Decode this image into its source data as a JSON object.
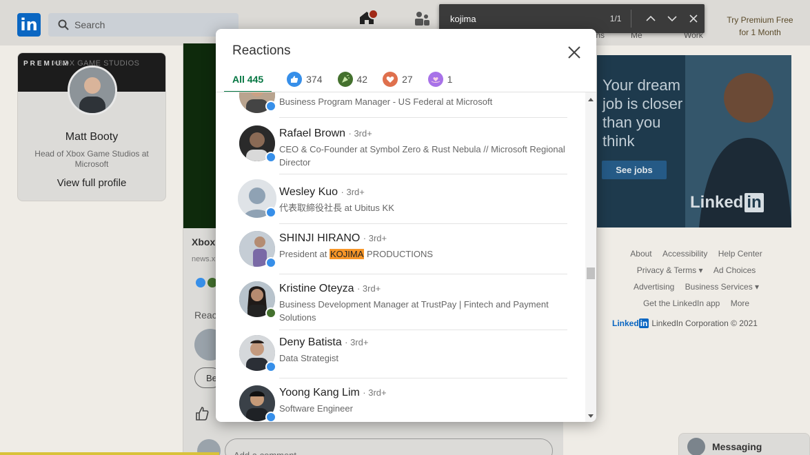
{
  "nav": {
    "search_placeholder": "Search",
    "labels": {
      "notifications": "ations",
      "me": "Me",
      "work": "Work"
    },
    "premium_line1": "Try Premium Free",
    "premium_line2": "for 1 Month"
  },
  "find": {
    "query": "kojima",
    "count": "1/1"
  },
  "profile": {
    "banner_text": "PREMIUM",
    "banner_studio": "XBOX GAME STUDIOS",
    "name": "Matt Booty",
    "title": "Head of Xbox Game Studios at Microsoft",
    "link": "View full profile"
  },
  "post": {
    "title": "Xbox",
    "source": "news.x",
    "reactions_label": "Reac",
    "pill_label": "Be",
    "comment_placeholder": "Add a comment..."
  },
  "ad": {
    "text": "Your dream job is closer than you think",
    "button": "See jobs",
    "logo_main": "Linked",
    "logo_in": "in"
  },
  "footer": {
    "row1": [
      "About",
      "Accessibility",
      "Help Center"
    ],
    "row2": [
      "Privacy & Terms",
      "Ad Choices"
    ],
    "row3": [
      "Advertising",
      "Business Services"
    ],
    "row4": [
      "Get the LinkedIn app",
      "More"
    ],
    "corp_logo": "Linked",
    "corp_logo_in": "in",
    "corp_text": "LinkedIn Corporation © 2021"
  },
  "messaging": {
    "label": "Messaging"
  },
  "modal": {
    "title": "Reactions",
    "tabs": [
      {
        "label": "All 445"
      },
      {
        "count": "374"
      },
      {
        "count": "42"
      },
      {
        "count": "27"
      },
      {
        "count": "1"
      }
    ],
    "rows": [
      {
        "name": "",
        "degree": "",
        "headline": "Business Program Manager - US Federal at Microsoft",
        "reaction": "like"
      },
      {
        "name": "Rafael Brown",
        "degree": "· 3rd+",
        "headline": "CEO & Co-Founder at Symbol Zero & Rust Nebula // Microsoft Regional Director",
        "reaction": "like"
      },
      {
        "name": "Wesley Kuo",
        "degree": "· 3rd+",
        "headline": "代表取締役社長 at Ubitus KK",
        "reaction": "like"
      },
      {
        "name": "SHINJI HIRANO",
        "degree": "· 3rd+",
        "headline_pre": "President at ",
        "headline_hl": "KOJIMA",
        "headline_post": " PRODUCTIONS",
        "reaction": "like"
      },
      {
        "name": "Kristine Oteyza",
        "degree": "· 3rd+",
        "headline": "Business Development Manager at TrustPay | Fintech and Payment Solutions",
        "reaction": "celebrate"
      },
      {
        "name": "Deny Batista",
        "degree": "· 3rd+",
        "headline": "Data Strategist",
        "reaction": "like"
      },
      {
        "name": "Yoong Kang Lim",
        "degree": "· 3rd+",
        "headline": "Software Engineer",
        "reaction": "like"
      }
    ]
  },
  "colors": {
    "linkedin_blue": "#0a66c2",
    "active_tab_green": "#057642",
    "like_blue": "#378fe9",
    "highlight_orange": "#f79628"
  }
}
